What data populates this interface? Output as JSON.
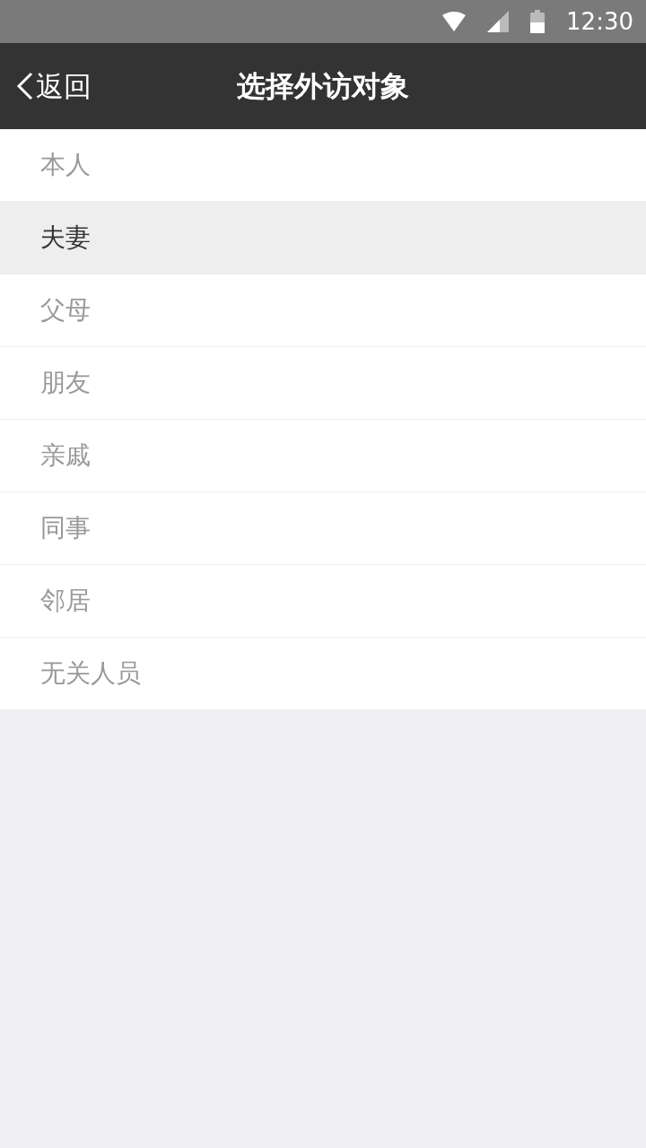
{
  "status_bar": {
    "time": "12:30"
  },
  "nav_bar": {
    "back_label": "返回",
    "title": "选择外访对象"
  },
  "items": [
    {
      "label": "本人",
      "selected": false
    },
    {
      "label": "夫妻",
      "selected": true
    },
    {
      "label": "父母",
      "selected": false
    },
    {
      "label": "朋友",
      "selected": false
    },
    {
      "label": "亲戚",
      "selected": false
    },
    {
      "label": "同事",
      "selected": false
    },
    {
      "label": "邻居",
      "selected": false
    },
    {
      "label": "无关人员",
      "selected": false
    }
  ]
}
